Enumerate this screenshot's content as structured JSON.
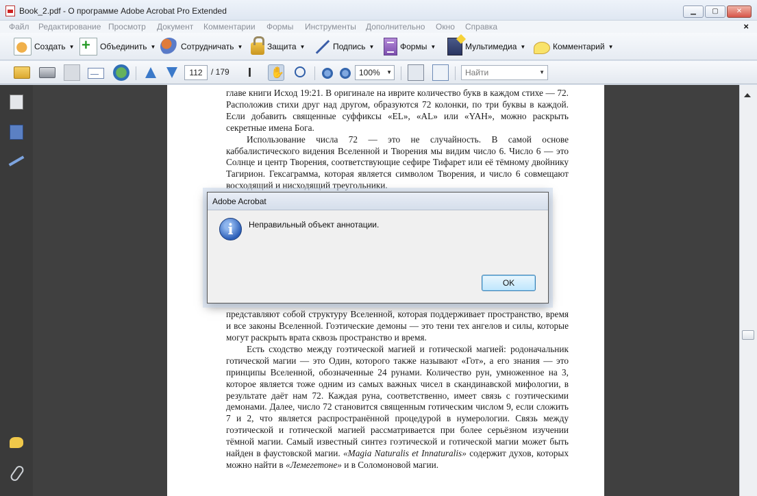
{
  "window": {
    "title": "Book_2.pdf - О программе Adobe Acrobat Pro Extended",
    "minimize": "▁",
    "maximize": "▢",
    "close": "✕"
  },
  "menu": {
    "items": [
      "Файл",
      "Редактирование",
      "Просмотр",
      "Документ",
      "Комментарии",
      "Формы",
      "Инструменты",
      "Дополнительно",
      "Окно",
      "Справка"
    ],
    "close_doc": "×"
  },
  "tasks": {
    "create": "Создать",
    "combine": "Объединить",
    "collaborate": "Сотрудничать",
    "secure": "Защита",
    "sign": "Подпись",
    "forms": "Формы",
    "multimedia": "Мультимедиа",
    "comment": "Комментарий",
    "caret": "▼"
  },
  "nav": {
    "page_current": "112",
    "page_total": "/ 179",
    "zoom": "100%",
    "search_placeholder": "Найти",
    "caret": "▼"
  },
  "document": {
    "paragraphs": [
      "главе книги Исход 19:21. В оригинале на иврите количество букв в каждом стихе — 72. Расположив стихи друг над другом, образуются 72 колонки, по три буквы в каждой.  Если добавить священные суффиксы «EL», «AL» или «YAH», можно раскрыть секретные имена Бога.",
      "Использование числа 72 — это не случайность. В самой основе каббалистического видения Вселенной и Творения мы видим число 6. Число 6 — это Солнце и центр Творения, соответствующие сефире Тифарет или её тёмному двойнику Тагирион. Гексаграмма, которая является символом Творения, и число 6 совмещают восходящий и нисходящий треугольники.",
      "представляют собой структуру Вселенной, которая поддерживает пространство, время и все законы Вселенной. Гоэтические демоны — это тени тех ангелов и силы, которые могут раскрыть врата сквозь пространство и время.",
      "Есть сходство между гоэтической магией и готической магией: родоначальник готической магии — это Один, которого также называют «Гот», а его знания — это принципы Вселенной, обозначенные 24 рунами. Количество рун, умноженное на 3, которое является тоже одним из самых важных чисел в скандинавской мифологии, в результате даёт нам 72. Каждая руна, соответственно, имеет связь с гоэтическими демонами. Далее, число 72 становится священным готическим числом 9, если сложить 7 и 2, что является распространённой процедурой в нумерологии. Связь между гоэтической и готической магией рассматривается при более серьёзном изучении тёмной магии. Самый известный синтез гоэтической и готической магии может быть найден в фаустовской магии.",
      "содержит духов, которых можно найти в",
      "и в Соломоновой магии."
    ],
    "italic_title_1": "«Magia Naturalis et Innaturalis»",
    "italic_title_2": "«Лемегетоне»"
  },
  "dialog": {
    "title": "Adobe Acrobat",
    "message": "Неправильный объект аннотации.",
    "ok_label": "OK"
  }
}
